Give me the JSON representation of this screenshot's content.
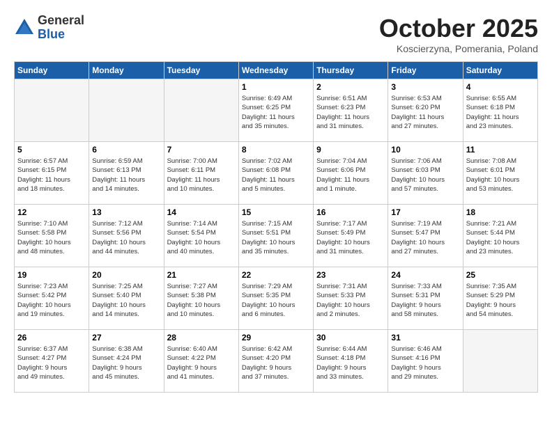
{
  "header": {
    "logo_line1": "General",
    "logo_line2": "Blue",
    "month": "October 2025",
    "location": "Koscierzyna, Pomerania, Poland"
  },
  "weekdays": [
    "Sunday",
    "Monday",
    "Tuesday",
    "Wednesday",
    "Thursday",
    "Friday",
    "Saturday"
  ],
  "weeks": [
    [
      {
        "day": "",
        "info": ""
      },
      {
        "day": "",
        "info": ""
      },
      {
        "day": "",
        "info": ""
      },
      {
        "day": "1",
        "info": "Sunrise: 6:49 AM\nSunset: 6:25 PM\nDaylight: 11 hours\nand 35 minutes."
      },
      {
        "day": "2",
        "info": "Sunrise: 6:51 AM\nSunset: 6:23 PM\nDaylight: 11 hours\nand 31 minutes."
      },
      {
        "day": "3",
        "info": "Sunrise: 6:53 AM\nSunset: 6:20 PM\nDaylight: 11 hours\nand 27 minutes."
      },
      {
        "day": "4",
        "info": "Sunrise: 6:55 AM\nSunset: 6:18 PM\nDaylight: 11 hours\nand 23 minutes."
      }
    ],
    [
      {
        "day": "5",
        "info": "Sunrise: 6:57 AM\nSunset: 6:15 PM\nDaylight: 11 hours\nand 18 minutes."
      },
      {
        "day": "6",
        "info": "Sunrise: 6:59 AM\nSunset: 6:13 PM\nDaylight: 11 hours\nand 14 minutes."
      },
      {
        "day": "7",
        "info": "Sunrise: 7:00 AM\nSunset: 6:11 PM\nDaylight: 11 hours\nand 10 minutes."
      },
      {
        "day": "8",
        "info": "Sunrise: 7:02 AM\nSunset: 6:08 PM\nDaylight: 11 hours\nand 5 minutes."
      },
      {
        "day": "9",
        "info": "Sunrise: 7:04 AM\nSunset: 6:06 PM\nDaylight: 11 hours\nand 1 minute."
      },
      {
        "day": "10",
        "info": "Sunrise: 7:06 AM\nSunset: 6:03 PM\nDaylight: 10 hours\nand 57 minutes."
      },
      {
        "day": "11",
        "info": "Sunrise: 7:08 AM\nSunset: 6:01 PM\nDaylight: 10 hours\nand 53 minutes."
      }
    ],
    [
      {
        "day": "12",
        "info": "Sunrise: 7:10 AM\nSunset: 5:58 PM\nDaylight: 10 hours\nand 48 minutes."
      },
      {
        "day": "13",
        "info": "Sunrise: 7:12 AM\nSunset: 5:56 PM\nDaylight: 10 hours\nand 44 minutes."
      },
      {
        "day": "14",
        "info": "Sunrise: 7:14 AM\nSunset: 5:54 PM\nDaylight: 10 hours\nand 40 minutes."
      },
      {
        "day": "15",
        "info": "Sunrise: 7:15 AM\nSunset: 5:51 PM\nDaylight: 10 hours\nand 35 minutes."
      },
      {
        "day": "16",
        "info": "Sunrise: 7:17 AM\nSunset: 5:49 PM\nDaylight: 10 hours\nand 31 minutes."
      },
      {
        "day": "17",
        "info": "Sunrise: 7:19 AM\nSunset: 5:47 PM\nDaylight: 10 hours\nand 27 minutes."
      },
      {
        "day": "18",
        "info": "Sunrise: 7:21 AM\nSunset: 5:44 PM\nDaylight: 10 hours\nand 23 minutes."
      }
    ],
    [
      {
        "day": "19",
        "info": "Sunrise: 7:23 AM\nSunset: 5:42 PM\nDaylight: 10 hours\nand 19 minutes."
      },
      {
        "day": "20",
        "info": "Sunrise: 7:25 AM\nSunset: 5:40 PM\nDaylight: 10 hours\nand 14 minutes."
      },
      {
        "day": "21",
        "info": "Sunrise: 7:27 AM\nSunset: 5:38 PM\nDaylight: 10 hours\nand 10 minutes."
      },
      {
        "day": "22",
        "info": "Sunrise: 7:29 AM\nSunset: 5:35 PM\nDaylight: 10 hours\nand 6 minutes."
      },
      {
        "day": "23",
        "info": "Sunrise: 7:31 AM\nSunset: 5:33 PM\nDaylight: 10 hours\nand 2 minutes."
      },
      {
        "day": "24",
        "info": "Sunrise: 7:33 AM\nSunset: 5:31 PM\nDaylight: 9 hours\nand 58 minutes."
      },
      {
        "day": "25",
        "info": "Sunrise: 7:35 AM\nSunset: 5:29 PM\nDaylight: 9 hours\nand 54 minutes."
      }
    ],
    [
      {
        "day": "26",
        "info": "Sunrise: 6:37 AM\nSunset: 4:27 PM\nDaylight: 9 hours\nand 49 minutes."
      },
      {
        "day": "27",
        "info": "Sunrise: 6:38 AM\nSunset: 4:24 PM\nDaylight: 9 hours\nand 45 minutes."
      },
      {
        "day": "28",
        "info": "Sunrise: 6:40 AM\nSunset: 4:22 PM\nDaylight: 9 hours\nand 41 minutes."
      },
      {
        "day": "29",
        "info": "Sunrise: 6:42 AM\nSunset: 4:20 PM\nDaylight: 9 hours\nand 37 minutes."
      },
      {
        "day": "30",
        "info": "Sunrise: 6:44 AM\nSunset: 4:18 PM\nDaylight: 9 hours\nand 33 minutes."
      },
      {
        "day": "31",
        "info": "Sunrise: 6:46 AM\nSunset: 4:16 PM\nDaylight: 9 hours\nand 29 minutes."
      },
      {
        "day": "",
        "info": ""
      }
    ]
  ]
}
